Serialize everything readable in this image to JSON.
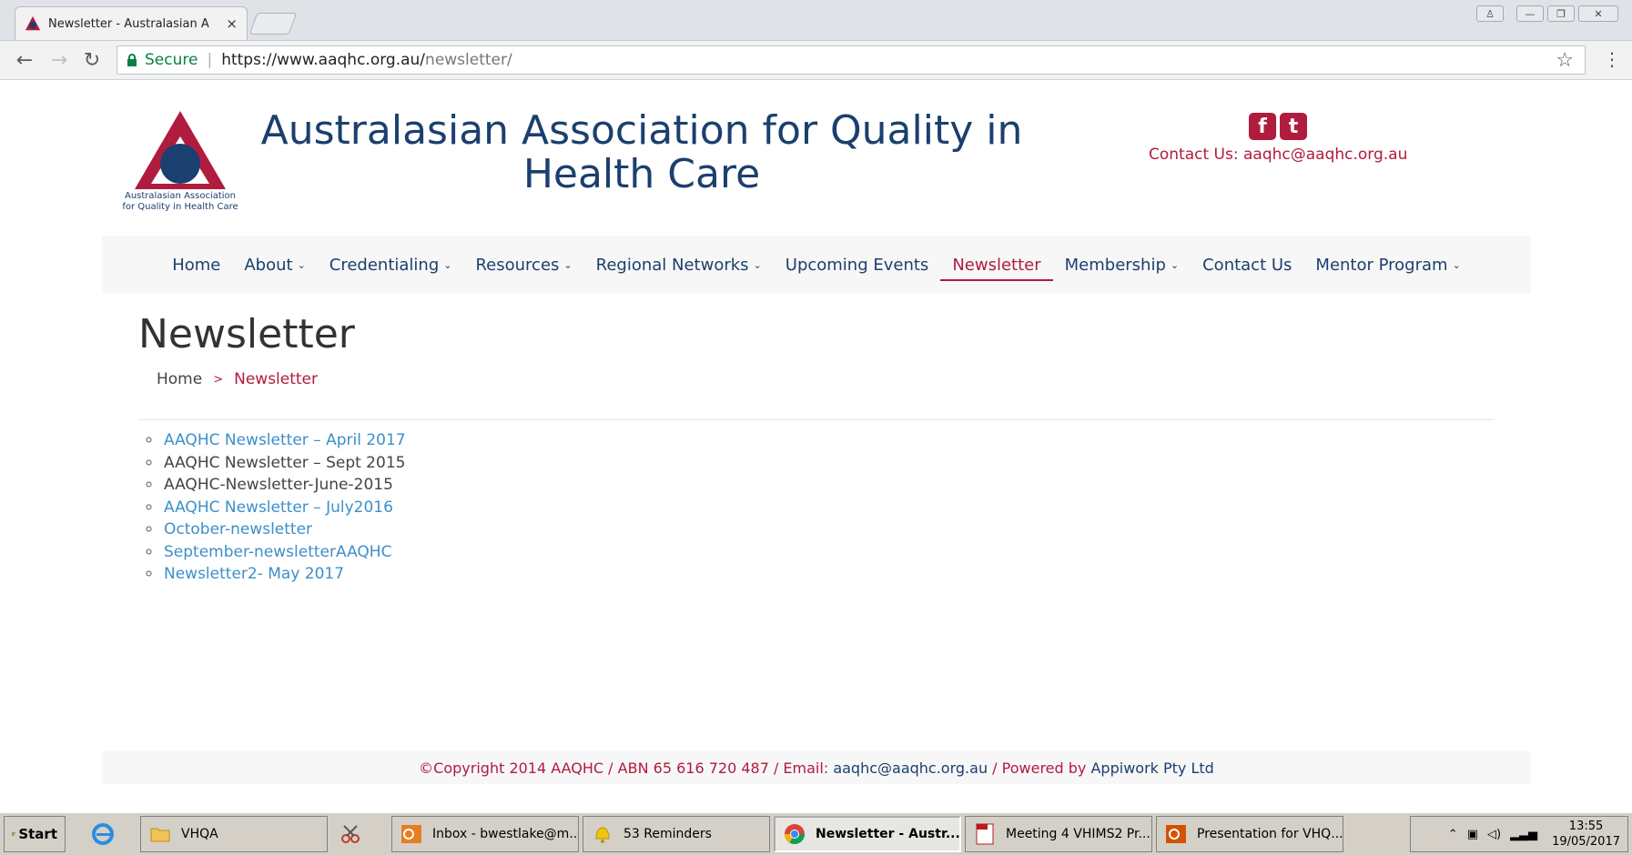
{
  "browser": {
    "tab_title": "Newsletter - Australasian A",
    "tab_close": "×",
    "secure_label": "Secure",
    "url_host": "https://www.aaqhc.org.au/",
    "url_path": "newsletter/",
    "back": "←",
    "forward": "→",
    "reload": "↻",
    "star": "☆",
    "menu": "⋮",
    "win_user": "♙",
    "win_min": "—",
    "win_max": "❐",
    "win_close": "✕"
  },
  "header": {
    "site_title": "Australasian Association for Quality in Health Care",
    "logo_caption_line1": "Australasian Association",
    "logo_caption_line2": "for Quality in Health Care",
    "facebook_glyph": "f",
    "twitter_glyph": "t",
    "contact_label": "Contact Us:",
    "contact_email": "aaqhc@aaqhc.org.au"
  },
  "nav": {
    "items": [
      {
        "label": "Home"
      },
      {
        "label": "About"
      },
      {
        "label": "Credentialing"
      },
      {
        "label": "Resources"
      },
      {
        "label": "Regional Networks"
      },
      {
        "label": "Upcoming Events"
      },
      {
        "label": "Newsletter"
      },
      {
        "label": "Membership"
      },
      {
        "label": "Contact Us"
      },
      {
        "label": "Mentor Program"
      }
    ],
    "chevron": "⌄"
  },
  "main": {
    "heading": "Newsletter",
    "breadcrumb_home": "Home",
    "breadcrumb_sep": ">",
    "breadcrumb_current": "Newsletter",
    "newsletters": [
      "AAQHC Newsletter – April 2017",
      "AAQHC Newsletter – Sept 2015",
      "AAQHC-Newsletter-June-2015",
      "AAQHC Newsletter – July2016",
      "October-newsletter",
      "September-newsletterAAQHC",
      "Newsletter2- May 2017"
    ]
  },
  "footer": {
    "copyright": "©Copyright 2014 AAQHC / ABN 65 616 720 487 / Email:",
    "email": "aaqhc@aaqhc.org.au",
    "powered": "/ Powered by",
    "company": "Appiwork Pty Ltd"
  },
  "taskbar": {
    "start": "Start",
    "items": [
      {
        "label": "VHQA"
      },
      {
        "label": "Inbox - bwestlake@m..."
      },
      {
        "label": "53 Reminders"
      },
      {
        "label": "Newsletter - Austr..."
      },
      {
        "label": "Meeting 4 VHIMS2 Pr..."
      },
      {
        "label": "Presentation for VHQ..."
      }
    ],
    "time": "13:55",
    "date": "19/05/2017"
  },
  "colors": {
    "brand_blue": "#1b3f6e",
    "brand_red": "#b01c3e",
    "link_blue": "#3d8fc9"
  }
}
